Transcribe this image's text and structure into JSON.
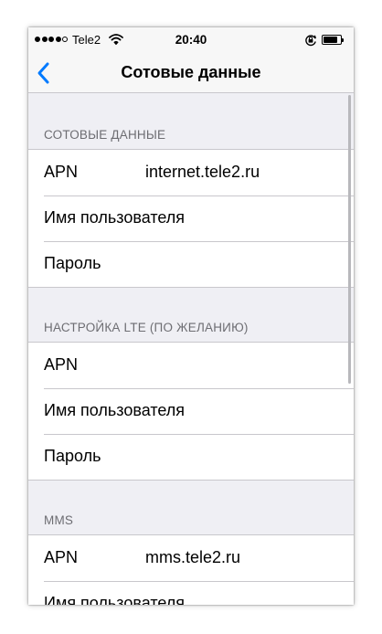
{
  "status_bar": {
    "carrier": "Tele2",
    "time": "20:40",
    "signal_bars_filled": 4,
    "signal_bars_total": 5
  },
  "nav": {
    "title": "Сотовые данные",
    "back_icon": "chevron-left-icon",
    "accent": "#007aff"
  },
  "sections": [
    {
      "header": "СОТОВЫЕ ДАННЫЕ",
      "rows": [
        {
          "label": "APN",
          "value": "internet.tele2.ru"
        },
        {
          "label": "Имя пользователя",
          "value": ""
        },
        {
          "label": "Пароль",
          "value": ""
        }
      ]
    },
    {
      "header": "НАСТРОЙКА LTE (ПО ЖЕЛАНИЮ)",
      "rows": [
        {
          "label": "APN",
          "value": ""
        },
        {
          "label": "Имя пользователя",
          "value": ""
        },
        {
          "label": "Пароль",
          "value": ""
        }
      ]
    },
    {
      "header": "MMS",
      "rows": [
        {
          "label": "APN",
          "value": "mms.tele2.ru"
        },
        {
          "label": "Имя пользователя",
          "value": ""
        }
      ]
    }
  ]
}
